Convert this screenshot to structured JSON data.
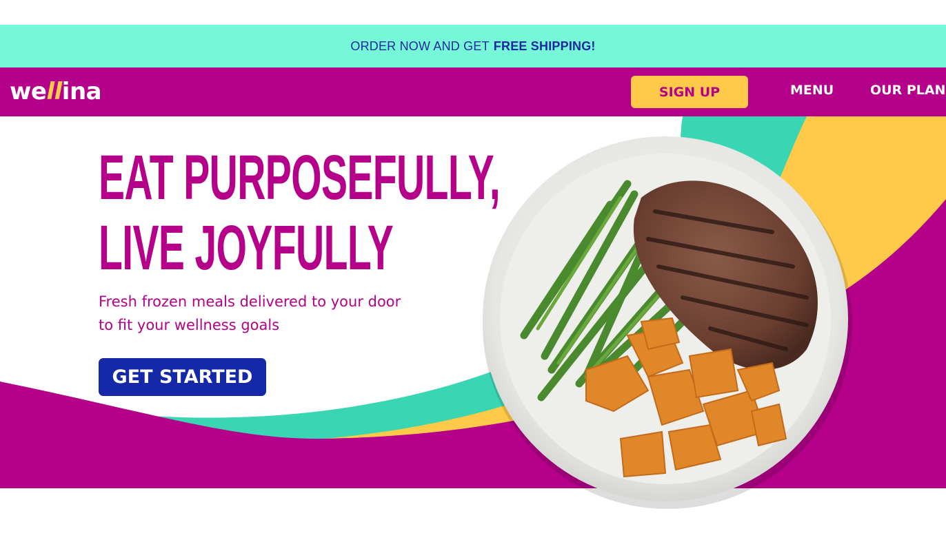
{
  "promo": {
    "text": "ORDER NOW AND GET",
    "highlight": "FREE SHIPPING!"
  },
  "nav": {
    "logo": {
      "pre": "we",
      "mid": "ll",
      "post": "ina"
    },
    "signup_label": "SIGN UP",
    "links": [
      {
        "label": "MENU"
      },
      {
        "label": "OUR PLAN"
      }
    ]
  },
  "hero": {
    "headline_line1": "EAT PURPOSEFULLY,",
    "headline_line2": "LIVE JOYFULLY",
    "subhead_line1": "Fresh frozen meals delivered to your door",
    "subhead_line2": "to fit your wellness goals",
    "cta_label": "GET STARTED"
  },
  "colors": {
    "promo_bg": "#75f7d8",
    "brand_magenta": "#b5008a",
    "accent_yellow": "#ffc94a",
    "accent_teal": "#3ad6b4",
    "cta_blue": "#1428a8"
  },
  "icons": {
    "logo": "wellina-logo",
    "hero_image": "steak-plate-image"
  }
}
